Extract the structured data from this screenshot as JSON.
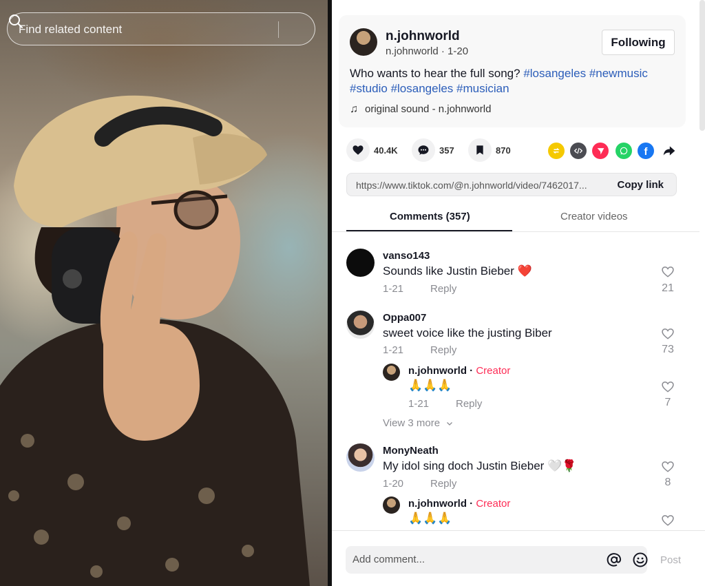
{
  "search": {
    "placeholder": "Find related content"
  },
  "post": {
    "username": "n.johnworld",
    "subline": "n.johnworld · 1-20",
    "follow_label": "Following",
    "caption_text": "Who wants to hear the full song?",
    "hashtags": [
      "#losangeles",
      "#newmusic",
      "#studio",
      "#losangeles",
      "#musician"
    ],
    "sound": "original sound - n.johnworld"
  },
  "stats": {
    "likes": "40.4K",
    "comments": "357",
    "saves": "870"
  },
  "share_icons": [
    "repost-icon",
    "embed-icon",
    "send-icon",
    "whatsapp-icon",
    "facebook-icon",
    "share-arrow-icon"
  ],
  "link": {
    "url": "https://www.tiktok.com/@n.johnworld/video/7462017...",
    "copy_label": "Copy link"
  },
  "tabs": {
    "comments": "Comments (357)",
    "creator_videos": "Creator videos"
  },
  "comments": [
    {
      "user": "vanso143",
      "text": "Sounds like Justin Bieber ❤️",
      "date": "1-21",
      "reply": "Reply",
      "likes": "21"
    },
    {
      "user": "Oppa007",
      "text": "sweet voice like the justing Biber",
      "date": "1-21",
      "reply": "Reply",
      "likes": "73",
      "replies": [
        {
          "user": "n.johnworld",
          "badge": "Creator",
          "text": "🙏🙏🙏",
          "date": "1-21",
          "reply": "Reply",
          "likes": "7"
        }
      ],
      "view_more": "View 3 more"
    },
    {
      "user": "MonyNeath",
      "text": "My idol sing doch Justin Bieber 🤍🌹",
      "date": "1-20",
      "reply": "Reply",
      "likes": "8",
      "replies": [
        {
          "user": "n.johnworld",
          "badge": "Creator",
          "text": "🙏🙏🙏"
        }
      ]
    }
  ],
  "composer": {
    "placeholder": "Add comment...",
    "post_label": "Post"
  },
  "colors": {
    "hashtag": "#2b5db9",
    "creator": "#fe2c55",
    "like_badge": "#f1f1f2"
  }
}
